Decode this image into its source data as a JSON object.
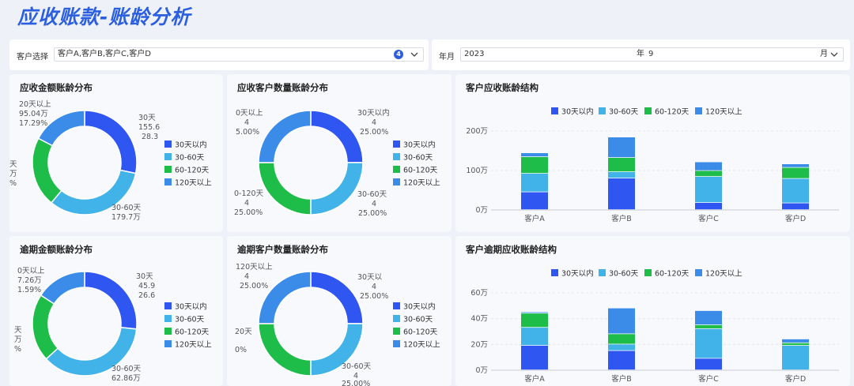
{
  "page": {
    "title": "应收账款-账龄分析"
  },
  "filters": {
    "customer_label": "客户选择",
    "customer_value": "客户A,客户B,客户C,客户D",
    "customer_count": "4",
    "year_month_label": "年月",
    "year_value": "2023",
    "year_unit": "年",
    "month_value": "9",
    "month_unit": "月"
  },
  "colors": {
    "d30": "#2f56f0",
    "d60": "#42b3e8",
    "d120": "#1ebd4a",
    "d120p": "#3a8ce8"
  },
  "legend": [
    "30天以内",
    "30-60天",
    "60-120天",
    "120天以上"
  ],
  "panels": {
    "p1_title": "应收金额账龄分布",
    "p2_title": "应收客户数量账龄分布",
    "p3_title": "客户应收账龄结构",
    "p4_title": "逾期金额账龄分布",
    "p5_title": "逾期客户数量账龄分布",
    "p6_title": "客户逾期应收账龄结构"
  },
  "donut_labels": {
    "p1": {
      "a1": "30天",
      "a2": "155.6",
      "a3": "28.3",
      "b1": "30-60天",
      "b2": "179.7万",
      "c1": "天",
      "c2": "万",
      "c3": "%",
      "d1": "20天以上",
      "d2": "95.04万",
      "d3": "17.29%"
    },
    "p2": {
      "a1": "30天以内",
      "a2": "4",
      "a3": "25.00%",
      "b1": "30-60天",
      "b2": "4",
      "b3": "25.00%",
      "c1": "0-120天",
      "c2": "4",
      "c3": "25.00%",
      "d1": "0天以上",
      "d2": "4",
      "d3": "5.00%"
    },
    "p4": {
      "a1": "30天",
      "a2": "45.9",
      "a3": "26.6",
      "b1": "30-60天",
      "b2": "62.86万",
      "c1": "天",
      "c2": "万",
      "c3": "%",
      "d1": "0天以上",
      "d2": "7.26万",
      "d3": "1.59%"
    },
    "p5": {
      "a1": "30天以",
      "a2": "4",
      "a3": "25.00%",
      "b1": "30-60天",
      "b2": "4",
      "b3": "25.00%",
      "c1": "20天",
      "c2": "0%",
      "d1": "120天以上",
      "d2": "4",
      "d3": "25.00%"
    }
  },
  "chart_data": [
    {
      "type": "pie",
      "title": "应收金额账龄分布",
      "categories": [
        "30天以内",
        "30-60天",
        "60-120天",
        "120天以上"
      ],
      "values": [
        155.6,
        179.7,
        119.4,
        95.04
      ],
      "unit": "万"
    },
    {
      "type": "pie",
      "title": "应收客户数量账龄分布",
      "categories": [
        "30天以内",
        "30-60天",
        "60-120天",
        "120天以上"
      ],
      "values": [
        4,
        4,
        4,
        4
      ]
    },
    {
      "type": "bar",
      "title": "客户应收账龄结构",
      "stacked": true,
      "categories": [
        "客户A",
        "客户B",
        "客户C",
        "客户D"
      ],
      "series": [
        {
          "name": "30天以内",
          "values": [
            45,
            80,
            18,
            17
          ]
        },
        {
          "name": "30-60天",
          "values": [
            47,
            16,
            66,
            62
          ]
        },
        {
          "name": "60-120天",
          "values": [
            42,
            36,
            15,
            28
          ]
        },
        {
          "name": "120天以上",
          "values": [
            10,
            52,
            22,
            9
          ]
        }
      ],
      "yticks": [
        "0万",
        "100万",
        "200万"
      ],
      "ylim": [
        0,
        200
      ]
    },
    {
      "type": "pie",
      "title": "逾期金额账龄分布",
      "categories": [
        "30天以内",
        "30-60天",
        "60-120天",
        "120天以上"
      ],
      "values": [
        45.9,
        62.86,
        36.2,
        27.26
      ],
      "unit": "万"
    },
    {
      "type": "pie",
      "title": "逾期客户数量账龄分布",
      "categories": [
        "30天以内",
        "30-60天",
        "60-120天",
        "120天以上"
      ],
      "values": [
        4,
        4,
        4,
        4
      ]
    },
    {
      "type": "bar",
      "title": "客户逾期应收账龄结构",
      "stacked": true,
      "categories": [
        "客户A",
        "客户B",
        "客户C",
        "客户D"
      ],
      "series": [
        {
          "name": "30天以内",
          "values": [
            19,
            15,
            9,
            0
          ]
        },
        {
          "name": "30-60天",
          "values": [
            14,
            5,
            23,
            19
          ]
        },
        {
          "name": "60-120天",
          "values": [
            11,
            8,
            3,
            2
          ]
        },
        {
          "name": "120天以上",
          "values": [
            1,
            20,
            11,
            3
          ]
        }
      ],
      "yticks": [
        "0万",
        "20万",
        "40万",
        "60万"
      ],
      "ylim": [
        0,
        60
      ]
    }
  ]
}
